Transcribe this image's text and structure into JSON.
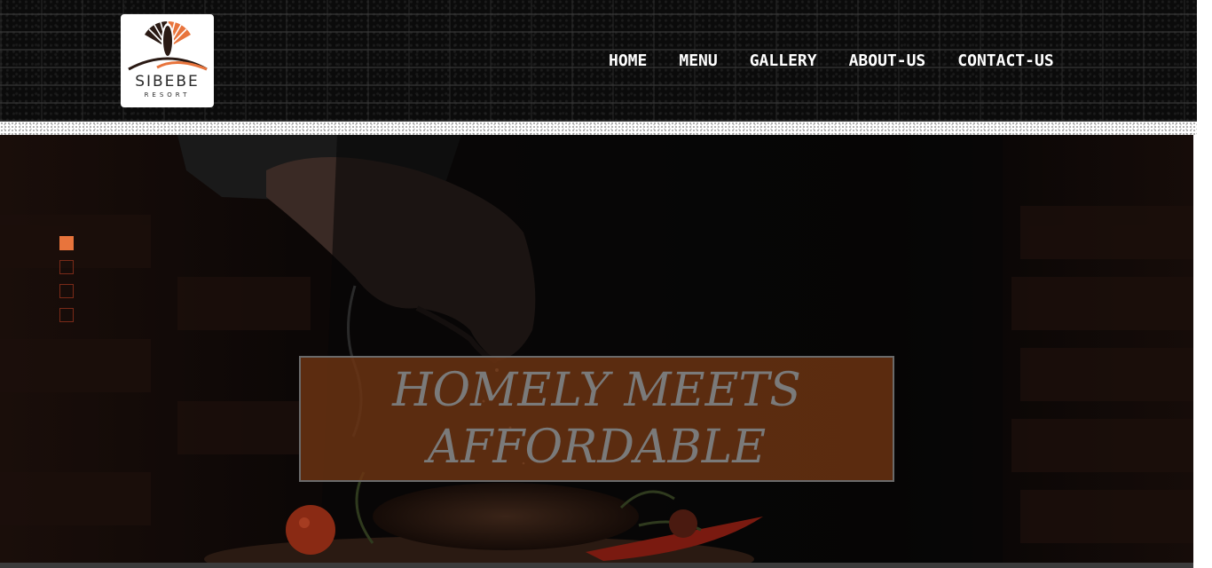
{
  "logo": {
    "name": "SIBEBE",
    "subtitle": "RESORT",
    "accent": "#e8743c"
  },
  "nav": {
    "items": [
      {
        "label": "HOME"
      },
      {
        "label": "MENU"
      },
      {
        "label": "GALLERY"
      },
      {
        "label": "ABOUT-US"
      },
      {
        "label": "CONTACT-US"
      }
    ]
  },
  "hero": {
    "headline_line1": "HOMELY MEETS",
    "headline_line2": "AFFORDABLE",
    "slides_count": 4,
    "active_slide": 1,
    "banner_color": "#6e3412",
    "active_dot_color": "#e8743c"
  }
}
